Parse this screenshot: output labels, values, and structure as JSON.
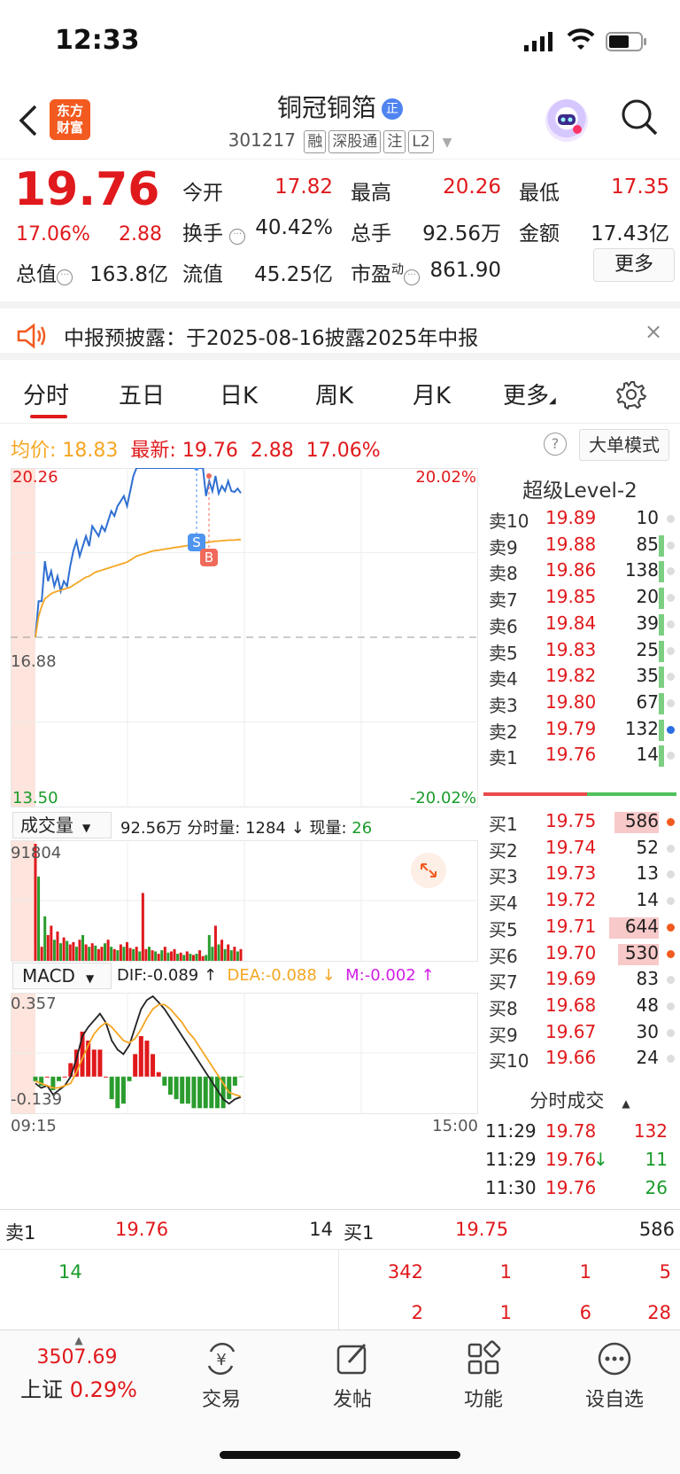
{
  "status_bar": {
    "time": "12:33"
  },
  "header": {
    "logo_line1": "东方",
    "logo_line2": "财富",
    "stock_name": "铜冠铜箔",
    "stock_code": "301217",
    "tags": [
      "融",
      "深股通",
      "注",
      "L2"
    ]
  },
  "quote": {
    "price": "19.76",
    "pct": "17.06%",
    "change": "2.88",
    "fields": [
      {
        "label": "今开",
        "value": "17.82",
        "color": "red"
      },
      {
        "label": "最高",
        "value": "20.26",
        "color": "red"
      },
      {
        "label": "最低",
        "value": "17.35",
        "color": "red"
      },
      {
        "label": "换手",
        "value": "40.42%",
        "color": "dark"
      },
      {
        "label": "总手",
        "value": "92.56万",
        "color": "dark"
      },
      {
        "label": "金额",
        "value": "17.43亿",
        "color": "dark"
      },
      {
        "label": "总值",
        "value": "163.8亿",
        "color": "dark"
      },
      {
        "label": "流值",
        "value": "45.25亿",
        "color": "dark"
      },
      {
        "label": "市盈",
        "value": "861.90",
        "color": "dark"
      }
    ],
    "pe_superscript": "动",
    "more_label": "更多"
  },
  "notice": {
    "text": "中报预披露：于2025-08-16披露2025年中报",
    "close": "×"
  },
  "tabs": [
    "分时",
    "五日",
    "日K",
    "周K",
    "月K",
    "更多"
  ],
  "info_line": {
    "avg_label": "均价:",
    "avg_value": "18.83",
    "latest_label": "最新:",
    "latest_value": "19.76",
    "change": "2.88",
    "pct": "17.06%",
    "help": "?",
    "big_mode": "大单模式"
  },
  "chart_data": {
    "type": "line",
    "title": "",
    "price_axis": {
      "top": "20.26",
      "mid": "16.88",
      "bottom": "13.50"
    },
    "pct_axis": {
      "top": "20.02%",
      "bottom": "-20.02%"
    },
    "ylim": [
      13.5,
      20.26
    ],
    "prev_close": 16.88,
    "time_start": "09:15",
    "time_end": "15:00",
    "series": [
      {
        "name": "",
        "color": "#2f6fd1",
        "values": [
          16.88,
          17.6,
          17.6,
          18.4,
          18.0,
          18.2,
          17.9,
          18.1,
          17.8,
          18.0,
          17.9,
          18.3,
          18.6,
          18.8,
          18.5,
          18.7,
          18.9,
          18.7,
          19.1,
          19.0,
          18.9,
          19.1,
          19.0,
          19.2,
          19.4,
          19.3,
          19.5,
          19.6,
          19.7,
          19.5,
          19.8,
          20.1,
          20.26,
          20.26,
          20.26,
          20.26,
          20.26,
          20.26,
          20.26,
          20.26,
          20.26,
          20.26,
          20.26,
          20.26,
          20.26,
          20.26,
          20.26,
          20.26,
          20.26,
          20.26,
          20.26,
          20.26,
          20.26,
          20.26,
          19.7,
          20.0,
          19.8,
          20.1,
          19.75,
          19.9,
          19.8,
          20.0,
          19.8,
          19.78,
          19.85,
          19.76
        ]
      },
      {
        "name": "",
        "color": "#f5a623",
        "values": [
          16.88,
          17.3,
          17.5,
          17.65,
          17.7,
          17.75,
          17.78,
          17.8,
          17.82,
          17.84,
          17.86,
          17.88,
          17.92,
          17.96,
          18.0,
          18.04,
          18.08,
          18.1,
          18.14,
          18.18,
          18.2,
          18.22,
          18.24,
          18.26,
          18.28,
          18.3,
          18.32,
          18.34,
          18.36,
          18.38,
          18.42,
          18.46,
          18.5,
          18.52,
          18.54,
          18.56,
          18.58,
          18.6,
          18.61,
          18.62,
          18.63,
          18.64,
          18.65,
          18.66,
          18.67,
          18.68,
          18.69,
          18.7,
          18.71,
          18.72,
          18.73,
          18.74,
          18.75,
          18.76,
          18.77,
          18.78,
          18.79,
          18.8,
          18.8,
          18.81,
          18.81,
          18.82,
          18.82,
          18.82,
          18.83,
          18.83
        ]
      }
    ],
    "markers": [
      {
        "label": "S",
        "color": "#4f94ef"
      },
      {
        "label": "B",
        "color": "#ef6a5a"
      }
    ],
    "volume": {
      "label": "成交量",
      "total": "92.56万",
      "period_label": "分时量:",
      "period_value": "1284",
      "now_label": "现量:",
      "now_value": "26",
      "max": "91804",
      "bars": [
        100,
        72,
        12,
        38,
        22,
        30,
        18,
        25,
        15,
        20,
        17,
        14,
        16,
        12,
        18,
        22,
        14,
        12,
        15,
        13,
        10,
        12,
        15,
        18,
        12,
        10,
        9,
        14,
        12,
        16,
        11,
        10,
        12,
        8,
        58,
        10,
        12,
        9,
        8,
        6,
        9,
        12,
        7,
        8,
        10,
        6,
        7,
        5,
        8,
        6,
        5,
        6,
        9,
        4,
        5,
        22,
        12,
        30,
        14,
        18,
        10,
        14,
        9,
        12,
        8,
        10
      ],
      "bar_colors": "rgrgrrgrgrgrrgrgrgrgrrgrgrgrgrrgrgrrgrgrgrgrrgrgrgrgrrgggrgrgrgrg"
    },
    "macd": {
      "label": "MACD",
      "dif_label": "DIF:",
      "dif_value": "-0.089",
      "dea_label": "DEA:",
      "dea_value": "-0.088",
      "m_label": "M:",
      "m_value": "-0.002",
      "top": "0.357",
      "bottom": "-0.139",
      "dif": [
        -0.03,
        -0.05,
        -0.04,
        -0.08,
        -0.06,
        -0.04,
        0.0,
        0.08,
        0.18,
        0.22,
        0.25,
        0.28,
        0.24,
        0.16,
        0.12,
        0.1,
        0.14,
        0.22,
        0.3,
        0.34,
        0.357,
        0.33,
        0.3,
        0.26,
        0.22,
        0.18,
        0.14,
        0.1,
        0.06,
        0.02,
        -0.02,
        -0.06,
        -0.1,
        -0.12,
        -0.1,
        -0.09
      ],
      "dea": [
        -0.02,
        -0.03,
        -0.04,
        -0.05,
        -0.05,
        -0.04,
        -0.03,
        0.02,
        0.08,
        0.14,
        0.19,
        0.22,
        0.24,
        0.22,
        0.19,
        0.16,
        0.15,
        0.17,
        0.21,
        0.26,
        0.3,
        0.32,
        0.32,
        0.3,
        0.27,
        0.24,
        0.2,
        0.17,
        0.13,
        0.09,
        0.05,
        0.01,
        -0.03,
        -0.07,
        -0.08,
        -0.088
      ],
      "hist": [
        -0.02,
        -0.04,
        0.0,
        -0.06,
        -0.02,
        0.0,
        0.06,
        0.12,
        0.2,
        0.16,
        0.12,
        0.12,
        0.0,
        -0.1,
        -0.14,
        -0.12,
        -0.02,
        0.1,
        0.18,
        0.16,
        0.1,
        0.02,
        -0.04,
        -0.08,
        -0.1,
        -0.12,
        -0.12,
        -0.14,
        -0.14,
        -0.14,
        -0.14,
        -0.14,
        -0.14,
        -0.1,
        -0.04,
        -0.002
      ]
    }
  },
  "level2": {
    "title": "超级Level-2",
    "asks": [
      {
        "label": "卖10",
        "price": "19.89",
        "vol": "10",
        "bar": 0,
        "dot": "gray"
      },
      {
        "label": "卖9",
        "price": "19.88",
        "vol": "85",
        "bar": 0.09,
        "dot": "gray"
      },
      {
        "label": "卖8",
        "price": "19.86",
        "vol": "138",
        "bar": 0.12,
        "dot": "gray"
      },
      {
        "label": "卖7",
        "price": "19.85",
        "vol": "20",
        "bar": 0.05,
        "dot": "gray"
      },
      {
        "label": "卖6",
        "price": "19.84",
        "vol": "39",
        "bar": 0.06,
        "dot": "gray"
      },
      {
        "label": "卖5",
        "price": "19.83",
        "vol": "25",
        "bar": 0.05,
        "dot": "gray"
      },
      {
        "label": "卖4",
        "price": "19.82",
        "vol": "35",
        "bar": 0.06,
        "dot": "gray"
      },
      {
        "label": "卖3",
        "price": "19.80",
        "vol": "67",
        "bar": 0.08,
        "dot": "gray"
      },
      {
        "label": "卖2",
        "price": "19.79",
        "vol": "132",
        "bar": 0.11,
        "dot": "blue"
      },
      {
        "label": "卖1",
        "price": "19.76",
        "vol": "14",
        "bar": 0.04,
        "dot": "gray"
      }
    ],
    "bids": [
      {
        "label": "买1",
        "price": "19.75",
        "vol": "586",
        "bar": 0.9,
        "dot": "orange"
      },
      {
        "label": "买2",
        "price": "19.74",
        "vol": "52",
        "bar": 0,
        "dot": "gray"
      },
      {
        "label": "买3",
        "price": "19.73",
        "vol": "13",
        "bar": 0,
        "dot": "gray"
      },
      {
        "label": "买4",
        "price": "19.72",
        "vol": "14",
        "bar": 0,
        "dot": "gray"
      },
      {
        "label": "买5",
        "price": "19.71",
        "vol": "644",
        "bar": 1.0,
        "dot": "orange"
      },
      {
        "label": "买6",
        "price": "19.70",
        "vol": "530",
        "bar": 0.82,
        "dot": "orange"
      },
      {
        "label": "买7",
        "price": "19.69",
        "vol": "83",
        "bar": 0,
        "dot": "gray"
      },
      {
        "label": "买8",
        "price": "19.68",
        "vol": "48",
        "bar": 0,
        "dot": "gray"
      },
      {
        "label": "买9",
        "price": "19.67",
        "vol": "30",
        "bar": 0,
        "dot": "gray"
      },
      {
        "label": "买10",
        "price": "19.66",
        "vol": "24",
        "bar": 0,
        "dot": "gray"
      }
    ],
    "ticks_title": "分时成交",
    "ticks": [
      {
        "time": "11:29",
        "price": "19.78",
        "vol": "132",
        "vol_color": "red",
        "arrow": ""
      },
      {
        "time": "11:29",
        "price": "19.76",
        "vol": "11",
        "vol_color": "green",
        "arrow": "↓"
      },
      {
        "time": "11:30",
        "price": "19.76",
        "vol": "26",
        "vol_color": "green",
        "arrow": ""
      }
    ]
  },
  "order_book": {
    "sell_label": "卖1",
    "sell_price": "19.76",
    "sell_vol": "14",
    "buy_label": "买1",
    "buy_price": "19.75",
    "buy_vol": "586",
    "sell_queue": [
      "14"
    ],
    "buy_queue_row1": [
      "342",
      "1",
      "1",
      "5"
    ],
    "buy_queue_row2": [
      "2",
      "1",
      "6",
      "28"
    ]
  },
  "bottom_nav": {
    "index_value": "3507.69",
    "index_name": "上证",
    "index_pct": "0.29%",
    "items": [
      "交易",
      "发帖",
      "功能",
      "设自选"
    ]
  }
}
